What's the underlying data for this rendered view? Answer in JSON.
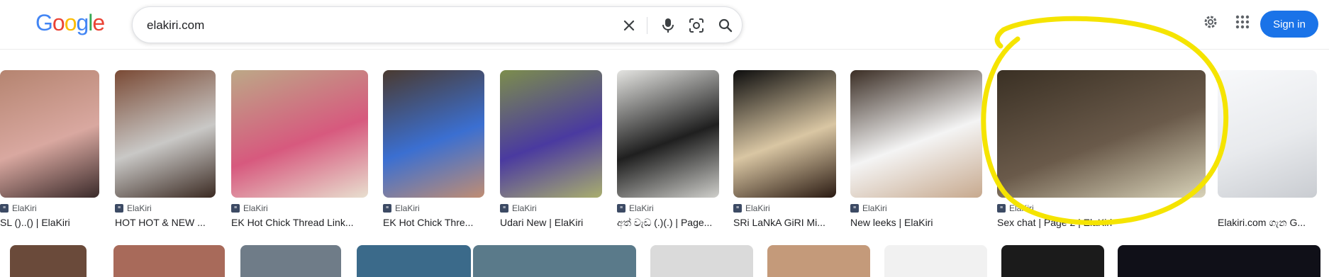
{
  "header": {
    "logo": [
      "G",
      "o",
      "o",
      "g",
      "l",
      "e"
    ],
    "logo_colors": [
      "#4285F4",
      "#EA4335",
      "#FBBC05",
      "#4285F4",
      "#34A853",
      "#EA4335"
    ],
    "search_value": "elakiri.com",
    "icons": {
      "clear": "close-icon",
      "voice": "microphone-icon",
      "lens": "lens-camera-icon",
      "search": "search-icon",
      "settings": "gear-icon",
      "apps": "apps-grid-icon"
    },
    "signin_label": "Sign in",
    "accent": "#1a73e8"
  },
  "results": [
    {
      "source": "ElaKiri",
      "caption": "SL ()..() | ElaKiri",
      "colors": [
        "#b58470",
        "#d9a8a0",
        "#3a2a2a"
      ]
    },
    {
      "source": "ElaKiri",
      "caption": "HOT HOT & NEW ...",
      "colors": [
        "#7a4a35",
        "#c9c8c6",
        "#3b2a22"
      ]
    },
    {
      "source": "ElaKiri",
      "caption": "EK Hot Chick Thread Link...",
      "colors": [
        "#bca887",
        "#d7597e",
        "#e8dfcf"
      ]
    },
    {
      "source": "ElaKiri",
      "caption": "EK Hot Chick Thre...",
      "colors": [
        "#4a3a30",
        "#3b6fd1",
        "#c08d73"
      ]
    },
    {
      "source": "ElaKiri",
      "caption": "Udari New | ElaKiri",
      "colors": [
        "#7c8d4c",
        "#4a3aa0",
        "#a9ae6e"
      ]
    },
    {
      "source": "ElaKiri",
      "caption": "අත් වැඩ (.)(.) | Page...",
      "colors": [
        "#e4e4e1",
        "#1f1f1f",
        "#cfcfcb"
      ]
    },
    {
      "source": "ElaKiri",
      "caption": "SRi LaNkA GiRI Mi...",
      "colors": [
        "#0d0d0d",
        "#d9c6a3",
        "#2a1a12"
      ]
    },
    {
      "source": "ElaKiri",
      "caption": "New leeks | ElaKiri",
      "colors": [
        "#3b2e25",
        "#f4f4f4",
        "#c7a98e"
      ]
    },
    {
      "source": "ElaKiri",
      "caption": "Sex chat | Page 2 | ElaKiri",
      "colors": [
        "#3a3024",
        "#6a5a4a",
        "#d8d2b8"
      ]
    },
    {
      "source": "",
      "caption": "Elakiri.com ගැන G...",
      "colors": [
        "#f8f9fb",
        "#e8eaed",
        "#c9ccd1"
      ]
    }
  ],
  "highlight_color": "#f5e400"
}
